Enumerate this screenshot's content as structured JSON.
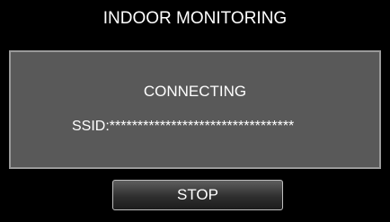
{
  "header": {
    "title": "INDOOR MONITORING"
  },
  "panel": {
    "status": "CONNECTING",
    "ssid_text": "SSID:*********************************"
  },
  "buttons": {
    "stop_label": "STOP"
  },
  "colors": {
    "background": "#000000",
    "panel_fill": "#595959",
    "panel_border": "#9a9a9a",
    "text": "#ffffff"
  }
}
